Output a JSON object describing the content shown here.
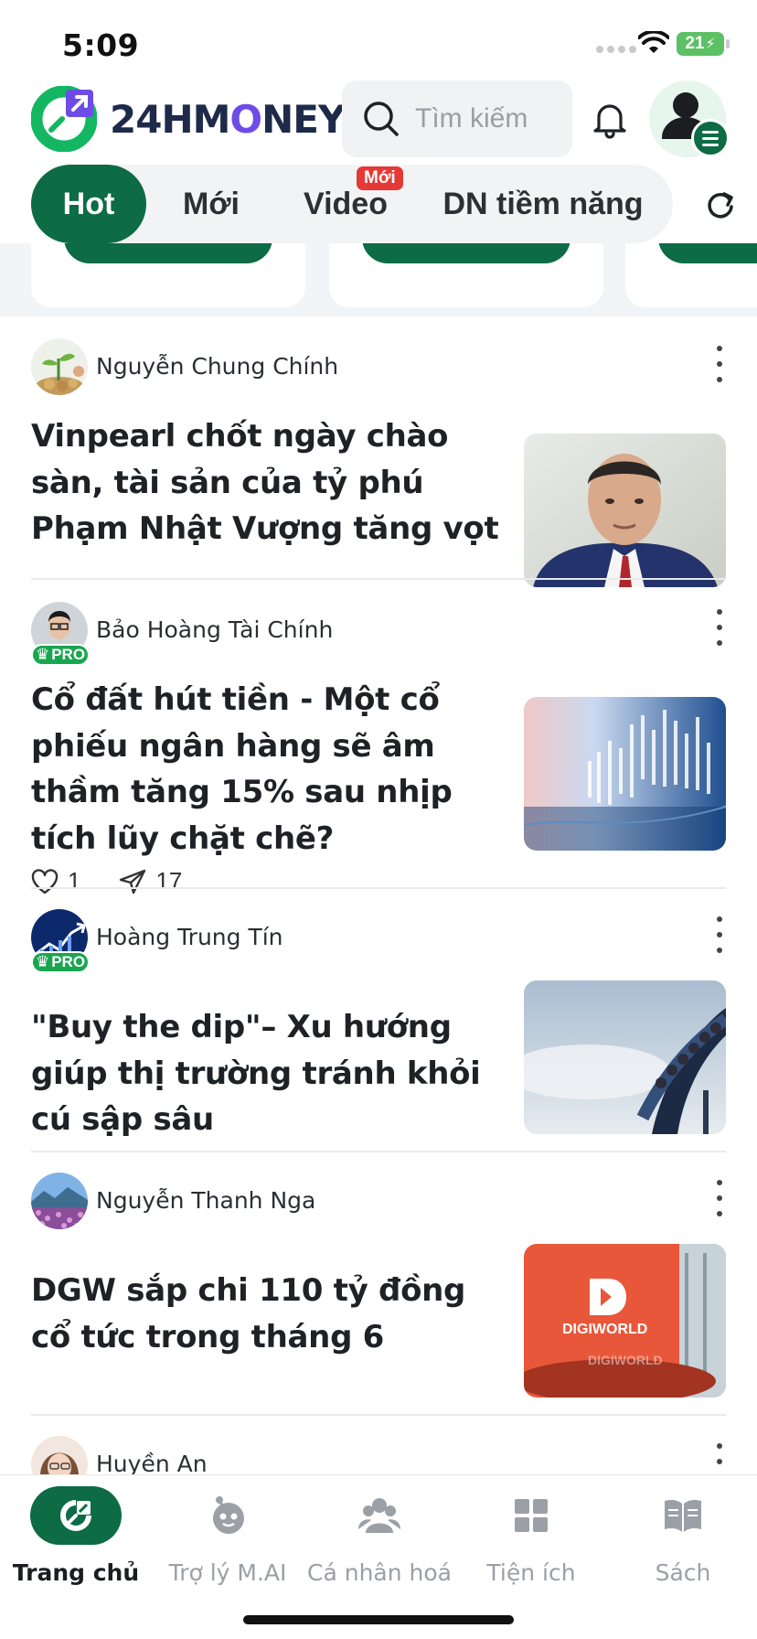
{
  "status_bar": {
    "time": "5:09",
    "battery": "21"
  },
  "header": {
    "logo_text_a": "24HM",
    "logo_text_o": "O",
    "logo_text_b": "NEY",
    "search_placeholder": "Tìm kiếm"
  },
  "tabs": [
    {
      "label": "Hot",
      "active": true
    },
    {
      "label": "Mới"
    },
    {
      "label": "Video",
      "badge": "Mới"
    },
    {
      "label": "DN tiềm năng"
    }
  ],
  "articles": [
    {
      "author": "Nguyễn Chung Chính",
      "pro": false,
      "title": "Vinpearl chốt ngày chào sàn, tài sản của tỷ phú Phạm Nhật Vượng tăng vọt",
      "thumbnail": "portrait-businessman"
    },
    {
      "author": "Bảo Hoàng Tài Chính",
      "pro": true,
      "pro_label": "PRO",
      "title": "Cổ đất hút tiền - Một cổ phiếu ngân hàng sẽ âm thầm tăng 15% sau nhịp tích lũy chặt chẽ?",
      "thumbnail": "stock-chart-blue",
      "likes": "1",
      "shares": "17"
    },
    {
      "author": "Hoàng Trung Tín",
      "pro": true,
      "pro_label": "PRO",
      "title": "\"Buy the dip\"– Xu hướng giúp thị trường tránh khỏi cú sập sâu",
      "thumbnail": "roller-coaster"
    },
    {
      "author": "Nguyễn Thanh Nga",
      "pro": false,
      "title": "DGW sắp chi 110 tỷ đồng cổ tức trong tháng 6",
      "thumbnail": "digiworld-office",
      "thumb_text_1": "DIGIWORLD",
      "thumb_text_2": "DIGIWORLD"
    },
    {
      "author": "Huyền An",
      "pro": false
    }
  ],
  "bottom_nav": [
    {
      "label": "Trang chủ",
      "icon": "home-logo-icon",
      "active": true
    },
    {
      "label": "Trợ lý M.AI",
      "icon": "robot-icon"
    },
    {
      "label": "Cá nhân hoá",
      "icon": "people-icon"
    },
    {
      "label": "Tiện ích",
      "icon": "grid-icon"
    },
    {
      "label": "Sách",
      "icon": "book-icon"
    }
  ],
  "colors": {
    "brand_green": "#0d6b45",
    "pro_green": "#19a64f",
    "badge_red": "#e53935"
  }
}
